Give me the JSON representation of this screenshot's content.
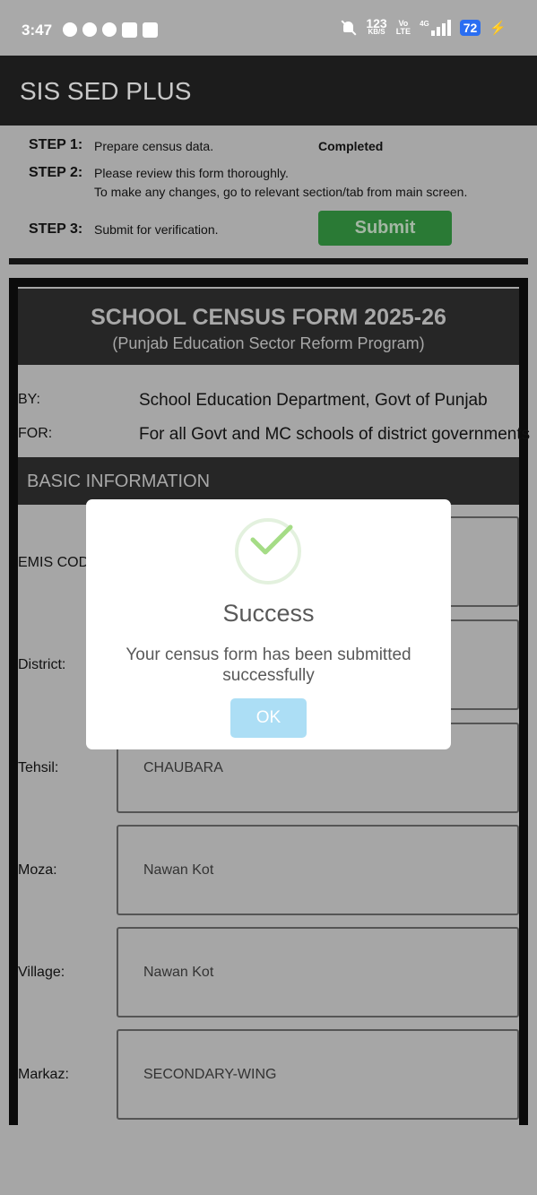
{
  "status_bar": {
    "time": "3:47",
    "net_speed_value": "123",
    "net_speed_unit": "KB/S",
    "volte_top": "Vo",
    "volte_bottom": "LTE",
    "network": "4G",
    "battery": "72",
    "icons": [
      "whatsapp-icon",
      "cloud-icon",
      "facebook-icon",
      "app-icon",
      "app-icon",
      "mute-icon",
      "signal-icon",
      "battery-icon",
      "charging-icon"
    ]
  },
  "app_bar": {
    "title": "SIS SED PLUS"
  },
  "steps": [
    {
      "label": "STEP 1:",
      "text": "Prepare census data.",
      "status": "Completed"
    },
    {
      "label": "STEP 2:",
      "text": "Please review this form thoroughly.",
      "text2": "To make any changes, go to relevant section/tab from main screen."
    },
    {
      "label": "STEP 3:",
      "text": "Submit for verification.",
      "button": "Submit"
    }
  ],
  "form": {
    "title": "SCHOOL CENSUS FORM 2025-26",
    "subtitle": "(Punjab Education Sector Reform Program)",
    "by_label": "BY:",
    "by_value": "School Education Department, Govt of Punjab",
    "for_label": "FOR:",
    "for_value": "For all Govt and MC schools of district governments",
    "section": "BASIC INFORMATION",
    "fields": [
      {
        "label": "EMIS CODE",
        "value": ""
      },
      {
        "label": "District:",
        "value": ""
      },
      {
        "label": "Tehsil:",
        "value": "CHAUBARA"
      },
      {
        "label": "Moza:",
        "value": "Nawan Kot"
      },
      {
        "label": "Village:",
        "value": "Nawan Kot"
      },
      {
        "label": "Markaz:",
        "value": "SECONDARY-WING"
      }
    ]
  },
  "dialog": {
    "title": "Success",
    "message": "Your census form has been submitted successfully",
    "ok_label": "OK"
  },
  "colors": {
    "overlay": "#a6a6a6",
    "app_bar": "#1c1c1c",
    "submit": "#2a7a35",
    "ok_button": "#acdef5",
    "check": "#a5dc86"
  }
}
